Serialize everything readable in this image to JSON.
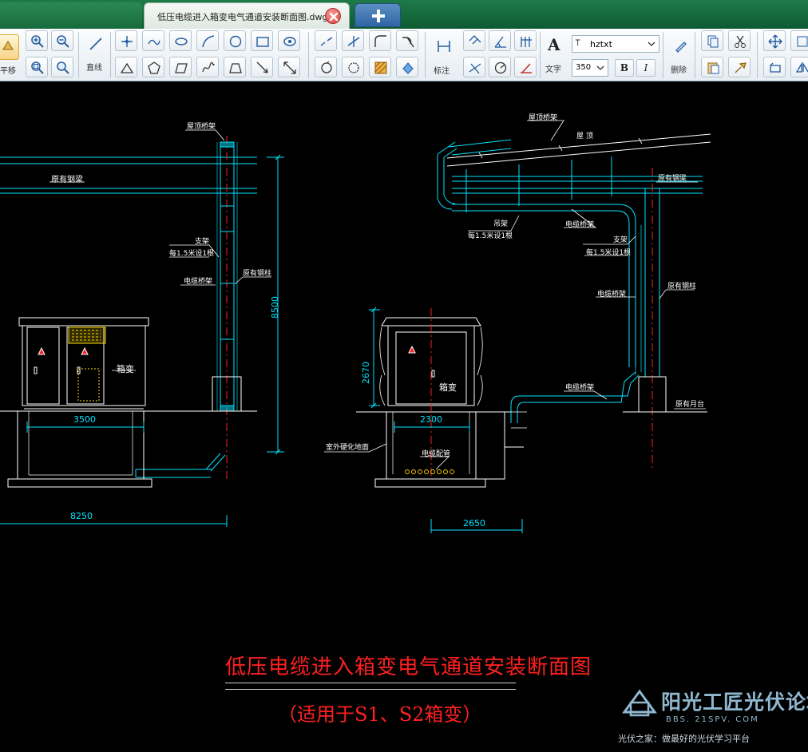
{
  "tabs": {
    "active_title": "低压电缆进入箱变电气通道安装断面图.dwg",
    "close_icon": "close-icon",
    "add_icon": "plus-icon"
  },
  "toolbar": {
    "pan_label": "平移",
    "line_label": "直线",
    "dimension_label": "标注",
    "text_label": "文字",
    "delete_label": "删除",
    "font_name": "hztxt",
    "font_size": "350",
    "bold_label": "B",
    "italic_label": "I"
  },
  "drawing": {
    "left_view": {
      "roof_bridge_label": "屋顶桥架",
      "steel_beam_label": "原有钢梁",
      "bracket_label": "支架",
      "bracket_spacing_label": "每1.5米设1根",
      "cable_tray_label": "电缆桥架",
      "steel_column_label": "原有钢柱",
      "box_label": "箱变",
      "dim_height": "8500",
      "dim_box_width": "3500",
      "dim_total_width": "8250"
    },
    "right_view": {
      "roof_tray_label": "屋顶桥架",
      "roof_label": "屋 顶",
      "steel_beam_label": "原有钢梁",
      "hanger_label": "吊架",
      "hanger_spacing_label": "每1.5米设1根",
      "cable_tray_top_label": "电缆桥架",
      "bracket_label": "支架",
      "bracket_spacing_label": "每1.5米设1根",
      "steel_column_label": "原有钢柱",
      "cable_tray_mid_label": "电缆桥架",
      "cable_tray_low_label": "电缆桥架",
      "platform_label": "原有月台",
      "ground_label": "室外硬化地面",
      "conduit_label": "电缆配管",
      "box_label": "箱变",
      "dim_box_height": "2670",
      "dim_box_width": "2300",
      "dim_offset": "2650"
    },
    "title": "低压电缆进入箱变电气通道安装断面图",
    "subtitle": "（适用于S1、S2箱变）"
  },
  "watermark": {
    "brand": "阳光工匠光伏论坛",
    "url": "BBS. 21SPV. COM",
    "slogan": "光伏之家：做最好的光伏学习平台"
  },
  "colors": {
    "cad_cyan": "#00e5ff",
    "cad_white": "#ffffff",
    "cad_red": "#ff2020",
    "cad_yellow": "#ffd800",
    "tab_green": "#1f7a49"
  }
}
